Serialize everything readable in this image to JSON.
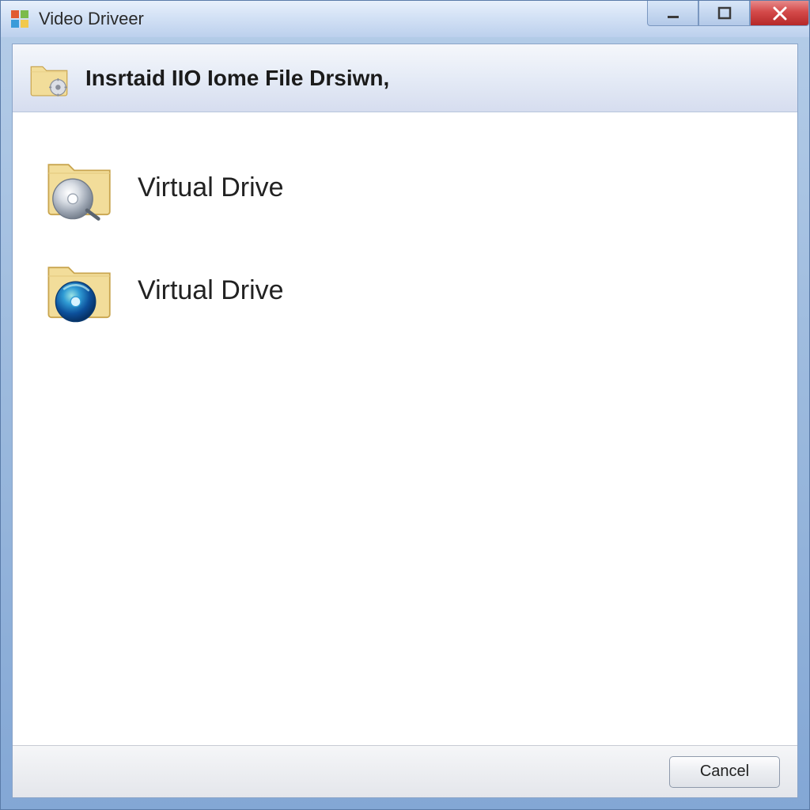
{
  "window": {
    "title": "Video Driveer"
  },
  "header": {
    "title": "Insrtaid IIO Iome File Drsiwn,"
  },
  "items": [
    {
      "label": "Virtual Drive",
      "icon": "folder-disc-silver"
    },
    {
      "label": "Virtual Drive",
      "icon": "folder-disc-blue"
    }
  ],
  "footer": {
    "cancel_label": "Cancel"
  },
  "colors": {
    "frame": "#9bb9dd",
    "close_btn": "#c3352b",
    "folder": "#f2dd9a",
    "folder_shade": "#d8be6e"
  }
}
